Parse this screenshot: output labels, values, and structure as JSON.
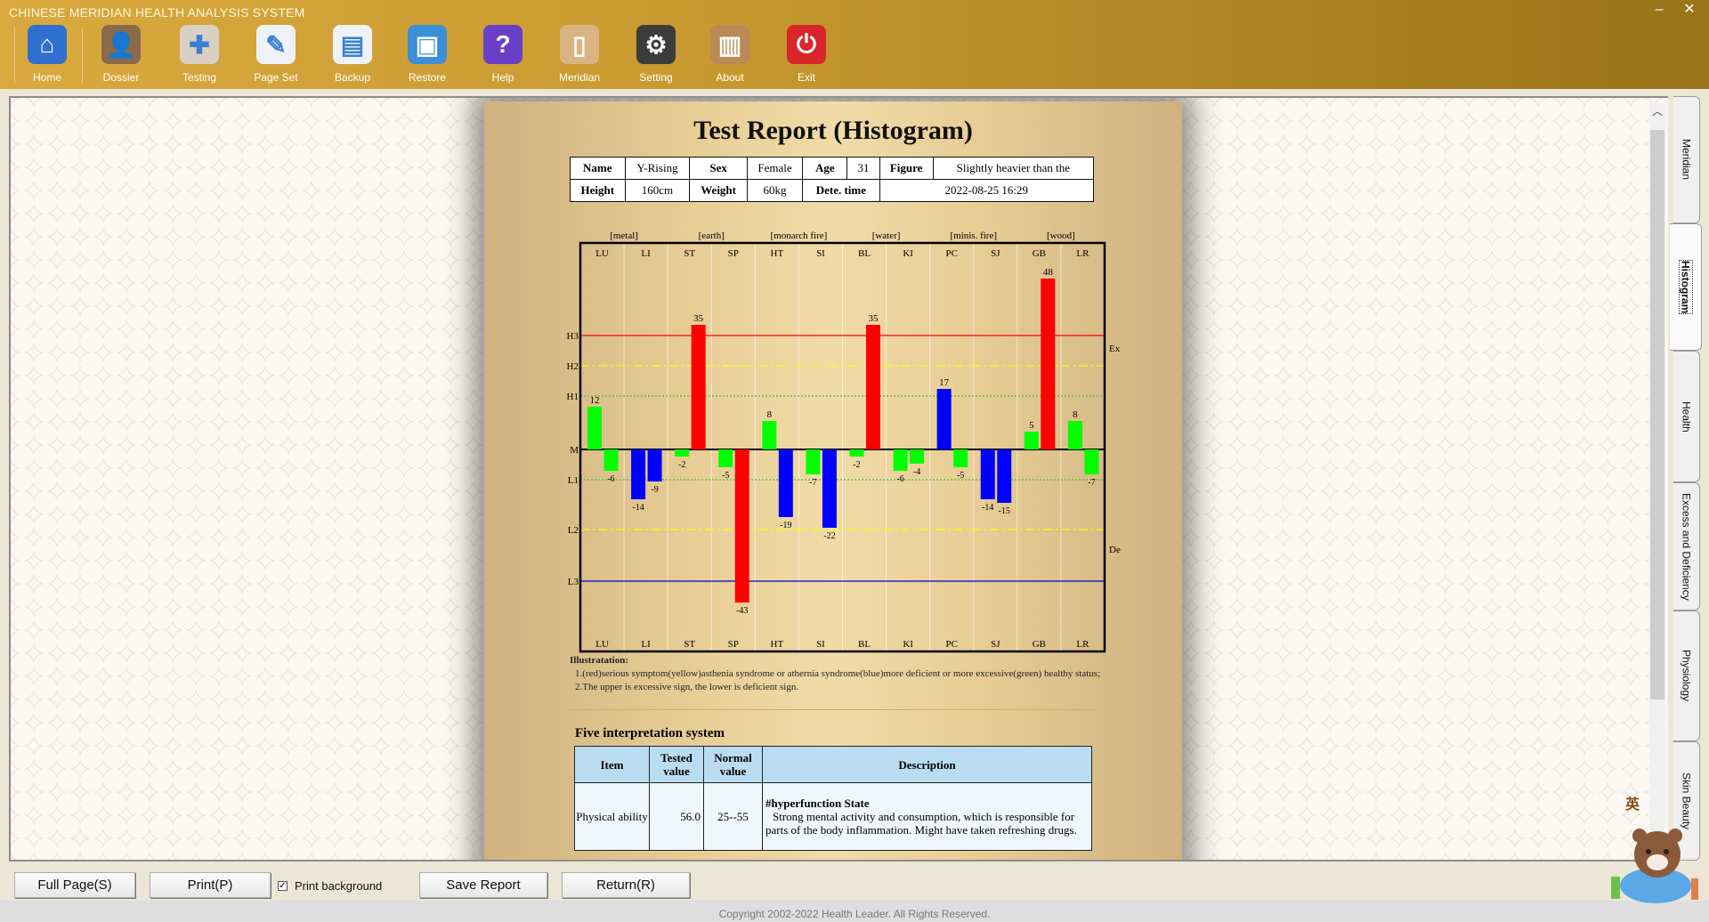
{
  "app": {
    "title": "CHINESE MERIDIAN HEALTH ANALYSIS SYSTEM",
    "minimize": "–",
    "close": "✕"
  },
  "toolbar": [
    {
      "label": "Home",
      "icon": "home-icon",
      "color": "#2f6fcf",
      "glyph": "⌂"
    },
    {
      "label": "Dossier",
      "icon": "users-icon",
      "color": "#8a6a4a",
      "glyph": "👤"
    },
    {
      "label": "Testing",
      "icon": "doctor-icon",
      "color": "#d9d0c4",
      "glyph": "✚"
    },
    {
      "label": "Page Set",
      "icon": "document-edit-icon",
      "color": "#eef2f6",
      "glyph": "✎"
    },
    {
      "label": "Backup",
      "icon": "document-save-icon",
      "color": "#eef2f6",
      "glyph": "▤"
    },
    {
      "label": "Restore",
      "icon": "floppy-icon",
      "color": "#3a8fd8",
      "glyph": "▣"
    },
    {
      "label": "Help",
      "icon": "help-icon",
      "color": "#6a3fc8",
      "glyph": "?"
    },
    {
      "label": "Meridian",
      "icon": "clipboard-icon",
      "color": "#d9b483",
      "glyph": "▯"
    },
    {
      "label": "Setting",
      "icon": "gear-icon",
      "color": "#3c3c3c",
      "glyph": "⚙"
    },
    {
      "label": "About",
      "icon": "book-icon",
      "color": "#b98a55",
      "glyph": "▥"
    },
    {
      "label": "Exit",
      "icon": "power-icon",
      "color": "#d8262a",
      "glyph": "⏻"
    }
  ],
  "report": {
    "title": "Test Report (Histogram)",
    "info": {
      "name_label": "Name",
      "name": "Y-Rising",
      "sex_label": "Sex",
      "sex": "Female",
      "age_label": "Age",
      "age": "31",
      "figure_label": "Figure",
      "figure": "Slightly heavier than the",
      "height_label": "Height",
      "height": "160cm",
      "weight_label": "Weight",
      "weight": "60kg",
      "time_label": "Dete. time",
      "time": "2022-08-25 16:29"
    },
    "illustration": {
      "heading": "Illustratation:",
      "line1": "1.(red)serious symptom(yellow)asthenia syndrome or athernia syndrome(blue)more deficient or more excessive(green) healthy status;",
      "line2": "2.The upper is excessive sign, the lower is deficient sign."
    },
    "five": {
      "title": "Five interpretation system",
      "headers": [
        "Item",
        "Tested value",
        "Normal value",
        "Description"
      ],
      "rows": [
        {
          "item": "Physical ability",
          "tested": "56.0",
          "normal": "25--55",
          "desc_title": "#hyperfunction State",
          "desc": "Strong mental activity and consumption, which is responsible for parts of the body inflammation. Might have taken refreshing drugs."
        }
      ]
    }
  },
  "chart_data": {
    "type": "bar",
    "categories": [
      "LU",
      "LI",
      "ST",
      "SP",
      "HT",
      "SI",
      "BL",
      "KI",
      "PC",
      "SJ",
      "GB",
      "LR"
    ],
    "elements": [
      "[metal]",
      "[earth]",
      "[monarch fire]",
      "[water]",
      "[minis. fire]",
      "[wood]"
    ],
    "series": [
      {
        "values": [
          12,
          -14,
          -2,
          -5,
          8,
          -7,
          -2,
          -6,
          17,
          -14,
          5,
          8
        ],
        "colors": [
          "#00ff00",
          "#0000ff",
          "#00ff00",
          "#00ff00",
          "#00ff00",
          "#00ff00",
          "#00ff00",
          "#00ff00",
          "#0000ff",
          "#0000ff",
          "#00ff00",
          "#00ff00"
        ]
      },
      {
        "values": [
          -6,
          -9,
          35,
          -43,
          -19,
          -22,
          35,
          -4,
          -5,
          -15,
          48,
          -7
        ],
        "colors": [
          "#00ff00",
          "#0000ff",
          "#ff0000",
          "#ff0000",
          "#0000ff",
          "#0000ff",
          "#ff0000",
          "#00ff00",
          "#00ff00",
          "#0000ff",
          "#ff0000",
          "#00ff00"
        ]
      }
    ],
    "reference_lines": [
      {
        "label": "H3",
        "value": 32,
        "color": "#ff0000",
        "style": "solid"
      },
      {
        "label": "H2",
        "value": 23.5,
        "color": "#ffff00",
        "style": "dashdot"
      },
      {
        "label": "H1",
        "value": 15,
        "color": "#33cc33",
        "style": "dotted"
      },
      {
        "label": "M",
        "value": 0,
        "color": "#000000",
        "style": "solid"
      },
      {
        "label": "L1",
        "value": -8.5,
        "color": "#33cc33",
        "style": "dotted"
      },
      {
        "label": "L2",
        "value": -22.5,
        "color": "#ffff00",
        "style": "dashdot"
      },
      {
        "label": "L3",
        "value": -37,
        "color": "#0000cc",
        "style": "solid"
      }
    ],
    "side_labels": [
      {
        "label": "Ex",
        "value": 28.5
      },
      {
        "label": "De",
        "value": -28
      }
    ],
    "ylim": [
      -58,
      58
    ]
  },
  "side_tabs": [
    {
      "label": "Meridian"
    },
    {
      "label": "Histogram",
      "selected": true
    },
    {
      "label": "Health"
    },
    {
      "label": "Excess and Deficiency"
    },
    {
      "label": "Physiology"
    },
    {
      "label": "Skin Beauty"
    }
  ],
  "bottom": {
    "full_page": "Full Page(S)",
    "print": "Print(P)",
    "print_bg": "Print background",
    "print_bg_checked": true,
    "save": "Save Report",
    "return": "Return(R)",
    "check_mark": "✓"
  },
  "copyright": "Copyright 2002-2022 Health Leader.  All Rights Reserved.",
  "mascot_text": "英"
}
